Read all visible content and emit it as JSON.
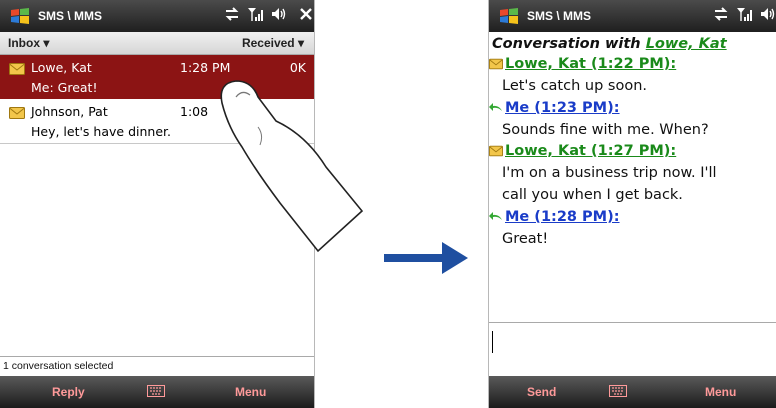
{
  "left": {
    "title": "SMS \\ MMS",
    "folder_label": "Inbox ▾",
    "sort_label": "Received ▾",
    "messages": [
      {
        "sender": "Lowe, Kat",
        "time": "1:28 PM",
        "size": "0K",
        "preview": "Me: Great!"
      },
      {
        "sender": "Johnson, Pat",
        "time": "1:08",
        "preview": "Hey, let's have dinner."
      }
    ],
    "status": "1 conversation selected",
    "soft_left": "Reply",
    "soft_right": "Menu"
  },
  "right": {
    "title": "SMS \\ MMS",
    "conversation_prefix": "Conversation with ",
    "conversation_contact": "Lowe, Kat",
    "entries": [
      {
        "header": "Lowe, Kat (1:22 PM):",
        "lines": [
          "Let's catch up soon."
        ]
      },
      {
        "header": "Me (1:23 PM):",
        "lines": [
          "Sounds fine with me. When?"
        ]
      },
      {
        "header": "Lowe, Kat (1:27 PM):",
        "lines": [
          "I'm on a business trip now. I'll",
          "call you when I get back."
        ]
      },
      {
        "header": "Me (1:28 PM):",
        "lines": [
          "Great!"
        ]
      }
    ],
    "soft_left": "Send",
    "soft_right": "Menu"
  },
  "icons": [
    "windows-logo",
    "sync-arrows-icon",
    "signal-icon",
    "volume-icon",
    "close-icon",
    "envelope-icon",
    "keyboard-icon",
    "reply-arrow-icon",
    "finger-tap",
    "right-arrow"
  ],
  "colors": {
    "selected_row": "#8c1414",
    "softkey_text": "#ff9a9a",
    "contact_header": "#1a8a1a",
    "me_header": "#1a3cc8",
    "arrow": "#1f4fa0"
  }
}
